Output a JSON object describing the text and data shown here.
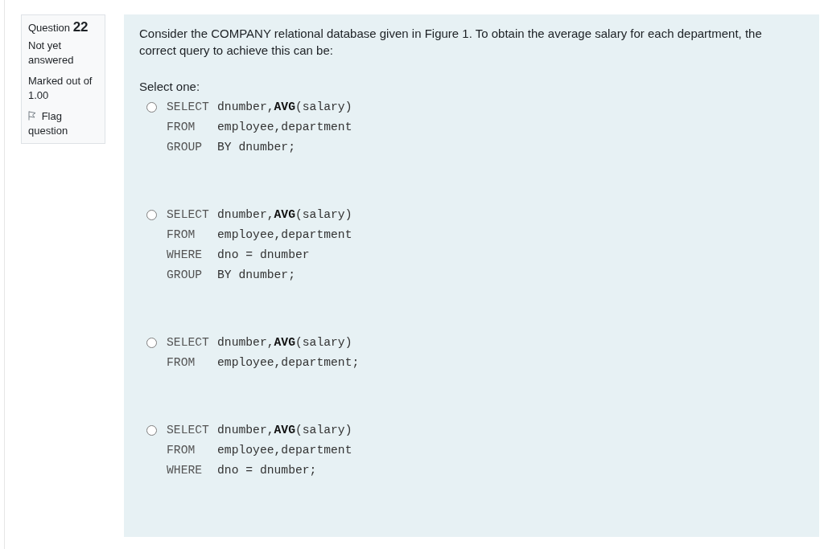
{
  "info": {
    "question_label": "Question",
    "question_number": "22",
    "state": "Not yet answered",
    "mark": "Marked out of 1.00",
    "flag": {
      "label": "Flag question",
      "flagged": false
    }
  },
  "question": {
    "text": "Consider the COMPANY relational database given in Figure 1. To obtain the average salary for each department, the correct query to achieve this can be:",
    "prompt": "Select one:",
    "options": [
      {
        "selected": false,
        "lines": [
          {
            "keyword": "SELECT",
            "text": "dnumber,**AVG**(salary)"
          },
          {
            "keyword": "FROM",
            "text": "employee,department"
          },
          {
            "keyword": "GROUP",
            "text": "BY dnumber;"
          }
        ]
      },
      {
        "selected": false,
        "lines": [
          {
            "keyword": "SELECT",
            "text": "dnumber,**AVG**(salary)"
          },
          {
            "keyword": "FROM",
            "text": "employee,department"
          },
          {
            "keyword": "WHERE",
            "text": "dno = dnumber"
          },
          {
            "keyword": "GROUP",
            "text": "BY dnumber;"
          }
        ]
      },
      {
        "selected": false,
        "lines": [
          {
            "keyword": "SELECT",
            "text": "dnumber,**AVG**(salary)"
          },
          {
            "keyword": "FROM",
            "text": "employee,department;"
          }
        ]
      },
      {
        "selected": false,
        "lines": [
          {
            "keyword": "SELECT",
            "text": "dnumber,**AVG**(salary)"
          },
          {
            "keyword": "FROM",
            "text": "employee,department"
          },
          {
            "keyword": "WHERE",
            "text": "dno = dnumber;"
          }
        ]
      }
    ]
  }
}
